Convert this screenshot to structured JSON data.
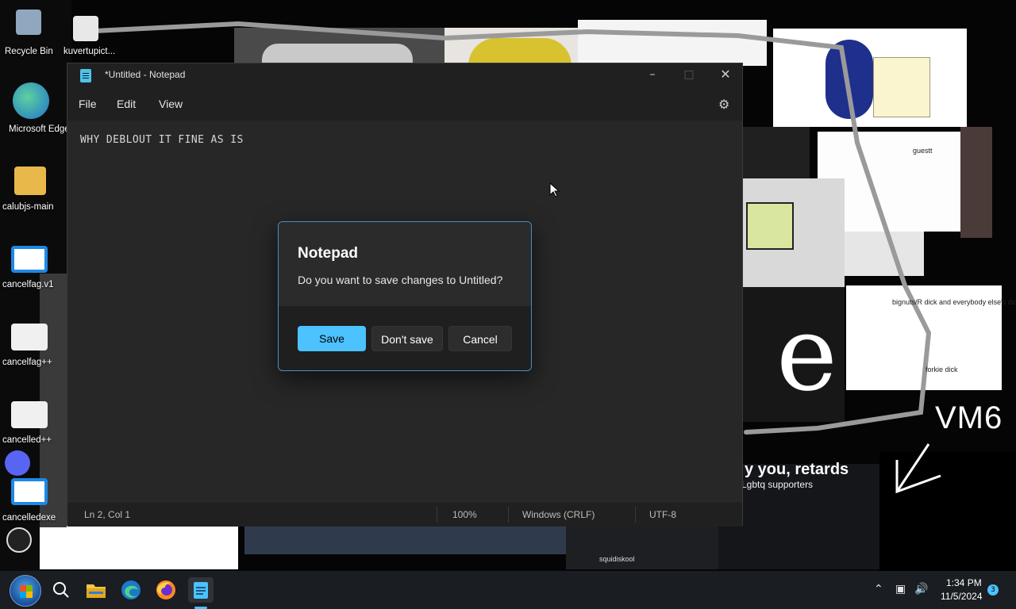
{
  "desktop": {
    "icons": [
      {
        "label": "Recycle Bin"
      },
      {
        "label": "kuvertupict..."
      },
      {
        "label": "Microsoft Edge"
      },
      {
        "label": "calubjs-main"
      },
      {
        "label": "cancelfag.v1"
      },
      {
        "label": "cancelfag++"
      },
      {
        "label": "cancelled++"
      },
      {
        "label": "cancelledexe"
      }
    ],
    "wallpaper_text": {
      "meme_title": "y you, retards",
      "meme_sub": "Lgbtq supporters",
      "vm_label": "VM6",
      "squid": "squidiskool",
      "note_a": "bignuts/R dick  and everybody else's dick",
      "note_b": "forkie dick",
      "fox": "guestt"
    }
  },
  "notepad": {
    "title": "*Untitled - Notepad",
    "menu": {
      "file": "File",
      "edit": "Edit",
      "view": "View"
    },
    "content": "WHY DEBLOUT IT FINE AS IS",
    "status": {
      "position": "Ln 2, Col 1",
      "zoom": "100%",
      "line_ending": "Windows (CRLF)",
      "encoding": "UTF-8"
    },
    "caption_icons": [
      "minimize-icon",
      "maximize-icon",
      "close-icon"
    ],
    "settings_icon": "gear-icon"
  },
  "dialog": {
    "title": "Notepad",
    "message": "Do you want to save changes to Untitled?",
    "buttons": {
      "save": "Save",
      "dont_save": "Don't save",
      "cancel": "Cancel"
    },
    "accent": "#4cc2ff"
  },
  "taskbar": {
    "pinned": [
      "start-orb-icon",
      "search-icon",
      "file-explorer-icon",
      "edge-icon",
      "firefox-icon",
      "notepad-icon"
    ],
    "clock_time": "1:34 PM",
    "clock_date": "11/5/2024",
    "notification_count": "3"
  }
}
